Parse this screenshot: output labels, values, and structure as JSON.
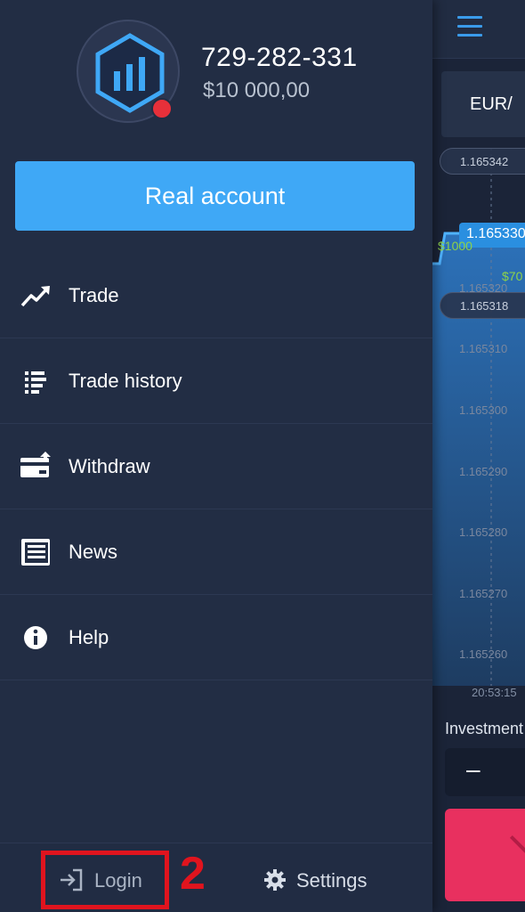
{
  "account": {
    "id": "729-282-331",
    "balance": "$10 000,00",
    "real_account_label": "Real account"
  },
  "menu": {
    "items": [
      {
        "label": "Trade",
        "icon": "trend-up-icon"
      },
      {
        "label": "Trade history",
        "icon": "list-icon"
      },
      {
        "label": "Withdraw",
        "icon": "card-icon"
      },
      {
        "label": "News",
        "icon": "newspaper-icon"
      },
      {
        "label": "Help",
        "icon": "info-icon"
      }
    ]
  },
  "footer": {
    "login_label": "Login",
    "settings_label": "Settings",
    "step_annotation": "2"
  },
  "background_app": {
    "pair": "EUR/",
    "price_pill_top": "1.165342",
    "price_pill_mid": "1.165318",
    "current_price": "1.165330",
    "trade_amount_1": "$1000",
    "trade_amount_2": "$70",
    "ticks": [
      "1.165320",
      "1.165310",
      "1.165300",
      "1.165290",
      "1.165280",
      "1.165270",
      "1.165260"
    ],
    "time": "20:53:15",
    "investment_label": "Investment",
    "minus_label": "–"
  },
  "colors": {
    "accent": "#3fa8f6",
    "drawer_bg": "#222d44",
    "highlight": "#e0141e",
    "sell": "#e8305f"
  }
}
